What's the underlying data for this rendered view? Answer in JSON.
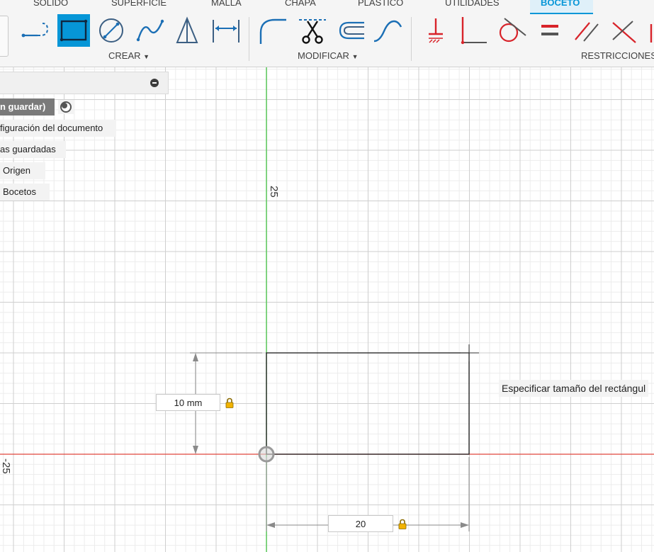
{
  "ribbon": {
    "tabs": [
      {
        "label": "SÓLIDO"
      },
      {
        "label": "SUPERFICIE"
      },
      {
        "label": "MALLA"
      },
      {
        "label": "CHAPA"
      },
      {
        "label": "PLÁSTICO"
      },
      {
        "label": "UTILIDADES"
      },
      {
        "label": "BOCETO",
        "active": true
      }
    ],
    "groups": {
      "create": "CREAR",
      "modify": "MODIFICAR",
      "constraints": "RESTRICCIONES"
    },
    "accent_color": "#0696d7"
  },
  "browser": {
    "document": "n guardar)",
    "items": [
      "figuración del documento",
      "as guardadas",
      "Origen",
      "Bocetos"
    ]
  },
  "canvas": {
    "axis_label_positive": "25",
    "axis_label_negative": "-25",
    "height_dimension": "10 mm",
    "width_dimension": "20",
    "tooltip": "Especificar tamaño del rectángul",
    "x_axis_color": "#e0463c",
    "y_axis_color": "#3ec83e"
  }
}
